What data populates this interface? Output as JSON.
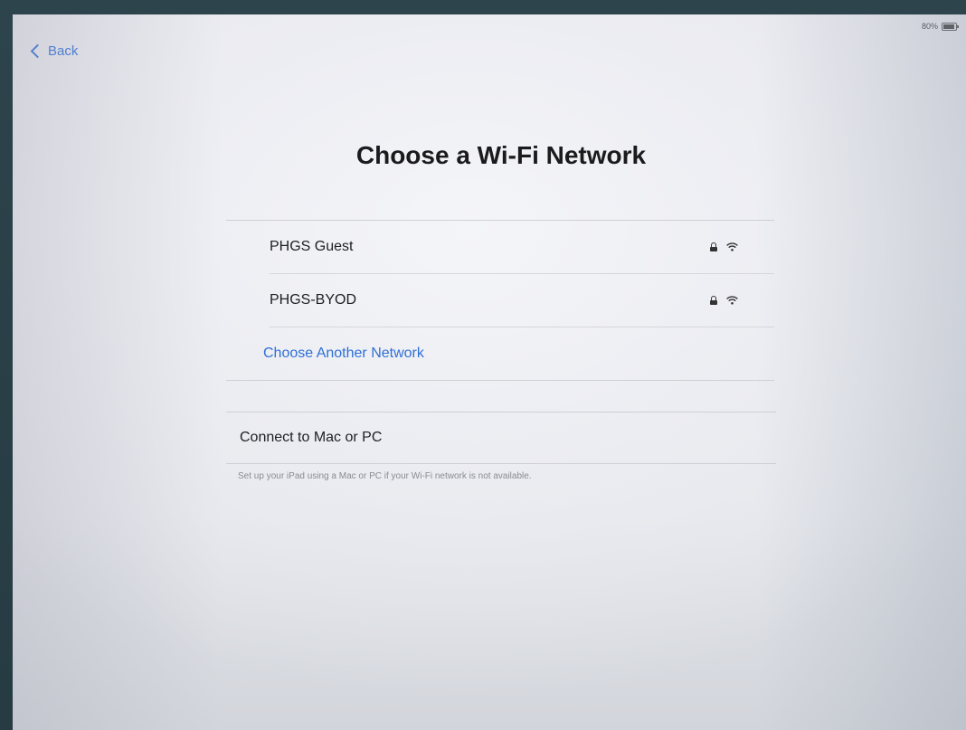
{
  "status_bar": {
    "battery_percent": "80%",
    "battery_level": 0.8
  },
  "nav": {
    "back_label": "Back"
  },
  "title": "Choose a Wi-Fi Network",
  "networks": [
    {
      "name": "PHGS Guest",
      "secured": true,
      "icons": [
        "lock-icon",
        "wifi-icon"
      ]
    },
    {
      "name": "PHGS-BYOD",
      "secured": true,
      "icons": [
        "lock-icon",
        "wifi-icon"
      ]
    }
  ],
  "other_network_label": "Choose Another Network",
  "connect": {
    "label": "Connect to Mac or PC",
    "footnote": "Set up your iPad using a Mac or PC if your Wi-Fi network is not available."
  },
  "colors": {
    "accent": "#2f6fd6",
    "text": "#1f1f22",
    "secondary_text": "#8a8b90",
    "bezel": "#2a4048"
  }
}
